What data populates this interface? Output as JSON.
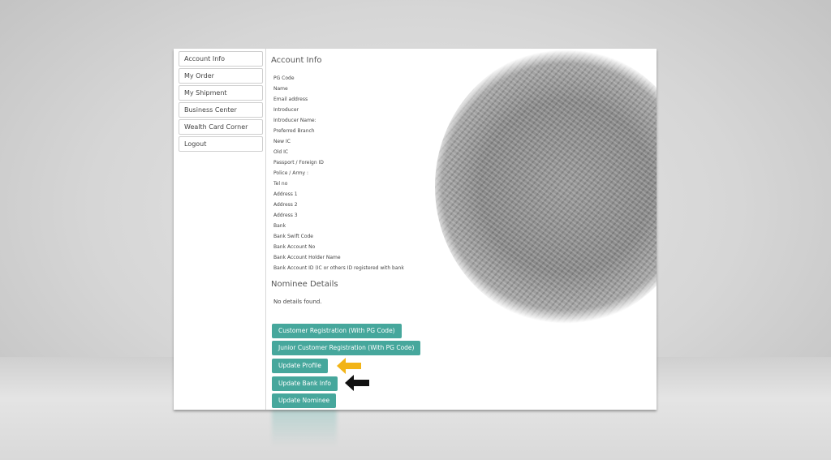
{
  "sidebar": {
    "items": [
      {
        "label": "Account Info"
      },
      {
        "label": "My Order"
      },
      {
        "label": "My Shipment"
      },
      {
        "label": "Business Center"
      },
      {
        "label": "Wealth Card Corner"
      },
      {
        "label": "Logout"
      }
    ]
  },
  "account": {
    "title": "Account Info",
    "fields": [
      "PG Code",
      "Name",
      "Email address",
      "Introducer",
      "Introducer Name:",
      "Preferred Branch",
      "New IC",
      "Old IC",
      "Passport / Foreign ID",
      "Police / Army :",
      "Tel no",
      "Address 1",
      "Address 2",
      "Address 3",
      "Bank",
      "Bank Swift Code",
      "Bank Account No",
      "Bank Account Holder Name",
      "Bank Account ID (IC or others ID registered with bank"
    ]
  },
  "nominee": {
    "title": "Nominee Details",
    "empty_text": "No details found."
  },
  "buttons": {
    "customer_registration": "Customer Registration (With PG Code)",
    "junior_registration": "Junior Customer Registration (With PG Code)",
    "update_profile": "Update Profile",
    "update_bank_info": "Update Bank Info",
    "update_nominee": "Update Nominee"
  },
  "colors": {
    "button": "#46a79c",
    "arrow_yellow": "#f2b417",
    "arrow_black": "#111111"
  }
}
